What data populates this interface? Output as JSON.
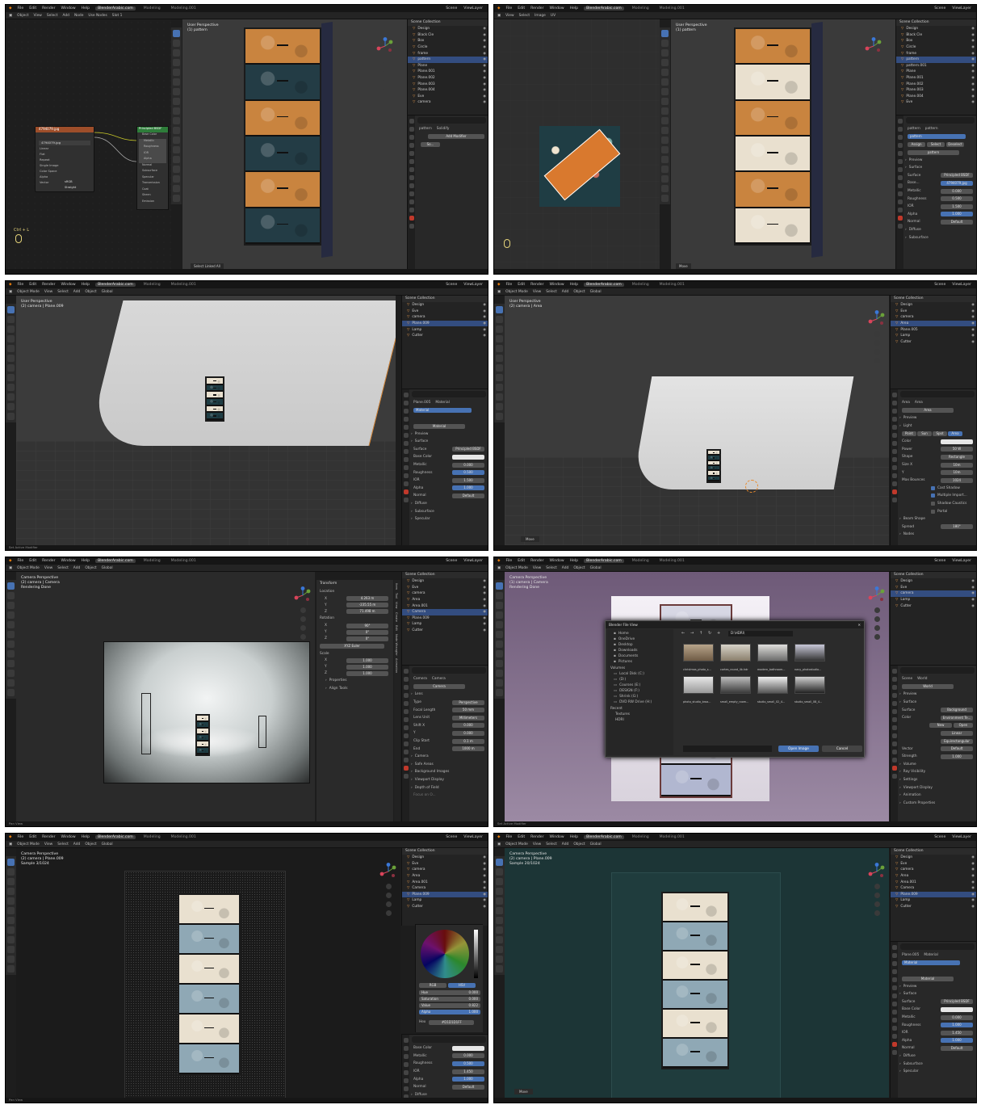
{
  "app": {
    "menu": [
      "File",
      "Edit",
      "Render",
      "Window",
      "Help"
    ],
    "site": "BlenderArabic.com",
    "workspaces": [
      "Modeling",
      "Modeling.001"
    ],
    "scene": "Scene",
    "view_layer": "ViewLayer",
    "search_placeholder": "Search",
    "options": "Options"
  },
  "colors": {
    "accent": "#4772b3",
    "selection": "#334d80",
    "panel": "#282828",
    "header": "#161616",
    "orange_pattern": "#d48a3c",
    "teal_pattern": "#1f3d44",
    "cream_pattern": "#e9e0cf"
  },
  "p1": {
    "header_items": [
      "Object",
      "View",
      "Select",
      "Add",
      "Node",
      "Use Nodes",
      "Slot 1"
    ],
    "breadcrumb": [
      "pattern",
      "Plane.016",
      "pattern"
    ],
    "image_node": "4794079.jpg",
    "image_field": "4794079.jpg",
    "node_labels": [
      "Linear",
      "Flat",
      "Repeat",
      "Single Image",
      "Color Space",
      "Alpha",
      "Vector"
    ],
    "node_values": [
      "sRGB",
      "Straight"
    ],
    "bsdf_node": "Principled BSDF",
    "bsdf_rows": [
      "Base Color",
      "Metallic",
      "Roughness",
      "IOR",
      "Alpha",
      "Normal",
      "Subsurface",
      "Specular",
      "Transmission",
      "Coat",
      "Sheen",
      "Emission"
    ],
    "shortcut": "Ctrl + L",
    "vp_title": "User Perspective",
    "vp_sub": "(1) pattern",
    "vp_status": "Select Linked All",
    "outliner_title": "Scene Collection",
    "outliner": [
      "Design",
      "Black Cle",
      "Box",
      "Circle",
      "frame",
      "pattern",
      "Plane",
      "Plane.001",
      "Plane.002",
      "Plane.003",
      "Plane.004",
      "Eve",
      "camera"
    ],
    "outliner_sel": 5,
    "props_bc": [
      "pattern",
      "Solidify"
    ],
    "add_modifier": "Add Modifier",
    "modifier": "So..."
  },
  "p2": {
    "header_items": [
      "View",
      "Select",
      "Image",
      "UV"
    ],
    "vp_title": "User Perspective",
    "vp_sub": "(1) pattern",
    "vp_status": "Move",
    "outliner": [
      "Design",
      "Black Cle",
      "Box",
      "Circle",
      "frame",
      "pattern",
      "pattern.001",
      "Plane",
      "Plane.001",
      "Plane.002",
      "Plane.003",
      "Plane.004",
      "Eve"
    ],
    "outliner_sel": 5,
    "props_bc": [
      "pattern",
      "pattern"
    ],
    "slot": "pattern",
    "slot_buttons": [
      "Assign",
      "Select",
      "Deselect"
    ],
    "material_field": "pattern",
    "sections": [
      "Preview",
      "Surface"
    ],
    "surface_label": "Surface",
    "surface_value": "Principled BSDF",
    "base_label": "Base...",
    "base_value": "4794079.jpg",
    "rows": [
      {
        "label": "Metallic",
        "value": "0.000"
      },
      {
        "label": "Roughness",
        "value": "0.500"
      },
      {
        "label": "IOR",
        "value": "1.500"
      },
      {
        "label": "Alpha",
        "value": "1.000"
      },
      {
        "label": "Normal",
        "value": "Default"
      }
    ],
    "more": [
      "Diffuse",
      "Subsurface"
    ]
  },
  "p3": {
    "header_items": [
      "Object Mode",
      "View",
      "Select",
      "Add",
      "Object",
      "Global"
    ],
    "vp_title": "User Perspective",
    "vp_sub": "(2) camera | Plane.009",
    "outliner": [
      "Design",
      "Eve",
      "camera",
      "Plane.009",
      "Lamp",
      "Cutter"
    ],
    "outliner_sel": 3,
    "props_bc": [
      "Plane.005",
      "Material"
    ],
    "material_slot": "Material",
    "material_field": "Material",
    "sections": [
      "Preview",
      "Surface"
    ],
    "surface_label": "Surface",
    "surface_value": "Principled BSDF",
    "rows": [
      {
        "label": "Base Color",
        "value": ""
      },
      {
        "label": "Metallic",
        "value": "0.000"
      },
      {
        "label": "Roughness",
        "value": "0.500"
      },
      {
        "label": "IOR",
        "value": "1.500"
      },
      {
        "label": "Alpha",
        "value": "1.000"
      },
      {
        "label": "Normal",
        "value": "Default"
      }
    ],
    "more": [
      "Diffuse",
      "Subsurface",
      "Specular"
    ],
    "status": "Set Active Modifier"
  },
  "p4": {
    "vp_title": "User Perspective",
    "vp_sub": "(2) camera | Area",
    "outliner": [
      "Design",
      "Eve",
      "camera",
      "Area",
      "Plane.005",
      "Lamp",
      "Cutter"
    ],
    "outliner_sel": 3,
    "props_bc": [
      "Area",
      "Area"
    ],
    "light_field": "Area",
    "sections": [
      "Preview",
      "Light"
    ],
    "light_types": [
      "Point",
      "Sun",
      "Spot",
      "Area"
    ],
    "rows": [
      {
        "label": "Color",
        "value": ""
      },
      {
        "label": "Power",
        "value": "50 W"
      },
      {
        "label": "Shape",
        "value": "Rectangle"
      },
      {
        "label": "Size X",
        "value": "10m"
      },
      {
        "label": "Y",
        "value": "10m"
      },
      {
        "label": "Max Bounces",
        "value": "1024"
      }
    ],
    "checks": [
      "Cast Shadow",
      "Multiple Import...",
      "Shadow Caustics",
      "Portal"
    ],
    "beam": "Beam Shape",
    "spread_label": "Spread",
    "spread_value": "180°",
    "nodes": "Nodes",
    "vp_status": "Move"
  },
  "p5": {
    "vp_title": "Camera Perspective",
    "vp_sub": "(2) camera | Camera",
    "vp_sub2": "Rendering Done",
    "transform": "Transform",
    "loc_label": "Location",
    "loc": [
      {
        "k": "X",
        "v": "4.263 m"
      },
      {
        "k": "Y",
        "v": "-235.55 m"
      },
      {
        "k": "Z",
        "v": "71.498 m"
      }
    ],
    "rot_label": "Rotation",
    "rot": [
      {
        "k": "X",
        "v": "90°"
      },
      {
        "k": "Y",
        "v": "0°"
      },
      {
        "k": "Z",
        "v": "0°"
      }
    ],
    "rot_mode": "XYZ Euler",
    "scale_label": "Scale",
    "scale": [
      {
        "k": "X",
        "v": "1.000"
      },
      {
        "k": "Y",
        "v": "1.000"
      },
      {
        "k": "Z",
        "v": "1.000"
      }
    ],
    "extra": [
      "Properties",
      "Align Tools"
    ],
    "outliner": [
      "Design",
      "Eve",
      "camera",
      "Area",
      "Area.001",
      "Camera",
      "Plane.009",
      "Lamp",
      "Cutter"
    ],
    "outliner_sel": 5,
    "props_bc": [
      "Camera",
      "Camera"
    ],
    "cam_field": "Camera",
    "lens": "Lens",
    "rows": [
      {
        "label": "Type",
        "value": "Perspective"
      },
      {
        "label": "Focal Length",
        "value": "50 mm"
      },
      {
        "label": "Lens Unit",
        "value": "Millimeters"
      },
      {
        "label": "Shift X",
        "value": "0.000"
      },
      {
        "label": "Y",
        "value": "0.000"
      },
      {
        "label": "Clip Start",
        "value": "0.1 m"
      },
      {
        "label": "End",
        "value": "1000 m"
      }
    ],
    "more": [
      "Camera",
      "Safe Areas",
      "Background Images",
      "Viewport Display",
      "Depth of Field"
    ],
    "focus": "Focus on O...",
    "side_tabs": [
      "Item",
      "Tool",
      "View",
      "Create",
      "Edit",
      "Node Wrangler",
      "Animation"
    ],
    "status": "Pan View"
  },
  "p6": {
    "vp_title": "Camera Perspective",
    "vp_sub": "(1) camera | Camera",
    "vp_sub2": "Rendering Done",
    "dialog_title": "Blender File View",
    "path": "D:\\HDRI\\",
    "places": [
      "Home",
      "OneDrive",
      "Desktop",
      "Downloads",
      "Documents",
      "Pictures"
    ],
    "volumes_label": "Volumes",
    "volumes": [
      "Local Disk (C:)",
      "(D:)",
      "Courses (E:)",
      "DESIGN (F:)",
      "Shrink (G:)",
      "DVD RW Drive (H:)"
    ],
    "recent_label": "Recent",
    "recent": [
      "Textures",
      "HDRI"
    ],
    "thumbs": [
      "christmas_photo_s...",
      "cortes_round_4k.hdr",
      "modern_bathroom...",
      "navy_photostudio...",
      "photo_studio_broa...",
      "small_empty_room...",
      "studio_small_02_4...",
      "studio_small_08_4..."
    ],
    "open_btn": "Open Image",
    "cancel_btn": "Cancel",
    "outliner": [
      "Design",
      "Eve",
      "camera",
      "Lamp",
      "Cutter"
    ],
    "outliner_sel": 2,
    "props_bc": [
      "Scene",
      "World"
    ],
    "world_field": "World",
    "sections": [
      "Preview",
      "Surface"
    ],
    "surface_label": "Surface",
    "surface_value": "Background",
    "color_label": "Color",
    "color_value": "Environment Te...",
    "new_btn": "New",
    "open_small": "Open",
    "rows": [
      {
        "label": "",
        "value": "Linear"
      },
      {
        "label": "",
        "value": "Equirectangular"
      },
      {
        "label": "Vector",
        "value": "Default"
      },
      {
        "label": "Strength",
        "value": "1.000"
      }
    ],
    "more": [
      "Volume",
      "Ray Visibility",
      "Settings",
      "Viewport Display",
      "Animation",
      "Custom Properties"
    ],
    "status": "Set Active Modifier"
  },
  "p7": {
    "vp_title": "Camera Perspective",
    "vp_sub": "(2) camera | Plane.009",
    "vp_sub2": "Sample 3/1024",
    "outliner": [
      "Design",
      "Eve",
      "camera",
      "Area",
      "Area.001",
      "Camera",
      "Plane.009",
      "Lamp",
      "Cutter"
    ],
    "outliner_sel": 6,
    "picker_tabs": [
      "RGB",
      "HSV"
    ],
    "picker_rows": [
      {
        "label": "Hue",
        "value": "0.000"
      },
      {
        "label": "Saturation",
        "value": "0.000"
      },
      {
        "label": "Value",
        "value": "0.822"
      },
      {
        "label": "Alpha",
        "value": "1.000"
      }
    ],
    "hex_label": "Hex",
    "hex_value": "#D1D1D1FF",
    "rows": [
      {
        "label": "Base Color",
        "value": ""
      },
      {
        "label": "Metallic",
        "value": "0.000"
      },
      {
        "label": "Roughness",
        "value": "0.500"
      },
      {
        "label": "IOR",
        "value": "1.450"
      },
      {
        "label": "Alpha",
        "value": "1.000"
      },
      {
        "label": "Normal",
        "value": "Default"
      }
    ],
    "more": [
      "Diffuse",
      "Subsurface",
      "Specular"
    ],
    "status": "Pan View"
  },
  "p8": {
    "vp_title": "Camera Perspective",
    "vp_sub": "(2) camera | Plane.009",
    "vp_sub2": "Sample 20/1024",
    "outliner": [
      "Design",
      "Eve",
      "camera",
      "Area",
      "Area.001",
      "Camera",
      "Plane.009",
      "Lamp",
      "Cutter"
    ],
    "outliner_sel": 6,
    "props_bc": [
      "Plane.005",
      "Material"
    ],
    "material_slot": "Material",
    "material_field": "Material",
    "sections": [
      "Preview",
      "Surface"
    ],
    "surface_label": "Surface",
    "surface_value": "Principled BSDF",
    "rows": [
      {
        "label": "Base Color",
        "value": ""
      },
      {
        "label": "Metallic",
        "value": "0.000"
      },
      {
        "label": "Roughness",
        "value": "1.000"
      },
      {
        "label": "IOR",
        "value": "1.450"
      },
      {
        "label": "Alpha",
        "value": "1.000"
      },
      {
        "label": "Normal",
        "value": "Default"
      }
    ],
    "more": [
      "Diffuse",
      "Subsurface",
      "Specular"
    ],
    "vp_status": "Move"
  }
}
